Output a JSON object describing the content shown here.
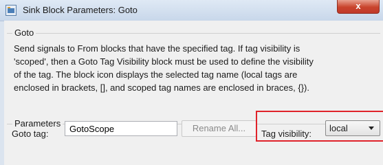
{
  "window": {
    "title": "Sink Block Parameters: Goto",
    "close_glyph": "x",
    "app_icon": "simulink-block-icon",
    "colors": {
      "close_button": "#c9442c",
      "highlight": "#e0222a"
    }
  },
  "goto_group": {
    "label": "Goto",
    "description": "Send signals to From blocks that have the specified tag.  If tag visibility is\n'scoped', then a Goto Tag Visibility block must be used to define the visibility\nof the tag.  The block icon displays the selected tag name (local tags are\nenclosed in brackets, [], and scoped tag names are enclosed in braces, {})."
  },
  "parameters_group": {
    "label": "Parameters",
    "goto_tag": {
      "label": "Goto tag:",
      "value": "GotoScope"
    },
    "rename_button": {
      "label": "Rename All..."
    },
    "tag_visibility": {
      "label": "Tag visibility:",
      "value": "local"
    }
  }
}
